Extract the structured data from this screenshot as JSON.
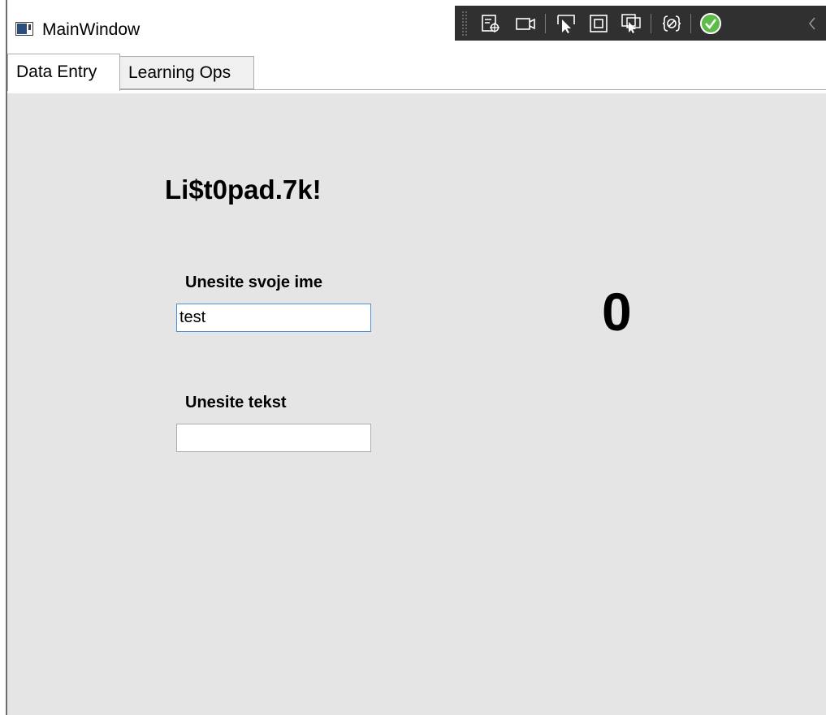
{
  "window": {
    "title": "MainWindow",
    "icon": "app-window-icon"
  },
  "debug_toolbar": {
    "tools": [
      {
        "icon": "select-element-icon"
      },
      {
        "icon": "video-icon"
      },
      {
        "icon": "pointer-select-icon"
      },
      {
        "icon": "display-layout-adorners-icon"
      },
      {
        "icon": "track-focus-icon"
      },
      {
        "icon": "binding-failures-icon"
      },
      {
        "icon": "check-circle-icon",
        "color": "#5dbb47"
      },
      {
        "icon": "collapse-chevron-icon"
      }
    ]
  },
  "tabs": [
    {
      "label": "Data Entry",
      "selected": true
    },
    {
      "label": "Learning Ops",
      "selected": false
    }
  ],
  "main": {
    "heading": "Li$t0pad.7k!",
    "name_label": "Unesite svoje ime",
    "name_value": "test",
    "text_label": "Unesite tekst",
    "text_value": "",
    "counter": "0"
  },
  "colors": {
    "content_bg": "#e5e5e5",
    "focus_border": "#4a90d9",
    "toolbar_bg": "#303030"
  }
}
